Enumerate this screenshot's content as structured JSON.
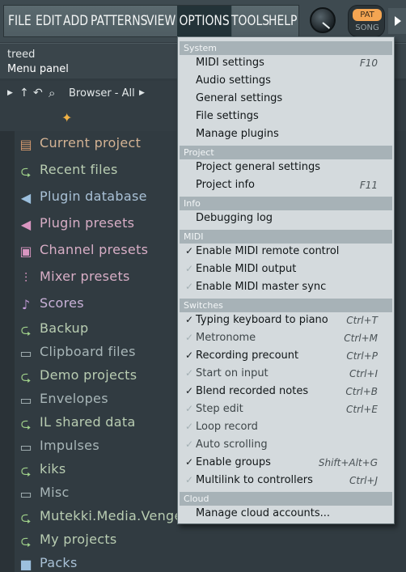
{
  "menubar": {
    "items": [
      {
        "label": "FILE"
      },
      {
        "label": "EDIT"
      },
      {
        "label": "ADD"
      },
      {
        "label": "PATTERNS"
      },
      {
        "label": "VIEW"
      },
      {
        "label": "OPTIONS"
      },
      {
        "label": "TOOLS"
      },
      {
        "label": "HELP"
      }
    ],
    "pat_label": "PAT",
    "song_label": "SONG"
  },
  "hint": {
    "line1": "treed",
    "line2": "Menu panel"
  },
  "browser": {
    "title": "Browser - All",
    "items": [
      {
        "label": "Current project",
        "icon": "document-icon",
        "color": "orange"
      },
      {
        "label": "Recent files",
        "icon": "folder-arrow-icon",
        "color": "green"
      },
      {
        "label": "Plugin database",
        "icon": "plug-icon",
        "color": "blue"
      },
      {
        "label": "Plugin presets",
        "icon": "plug-icon",
        "color": "pink"
      },
      {
        "label": "Channel presets",
        "icon": "channel-icon",
        "color": "pink"
      },
      {
        "label": "Mixer presets",
        "icon": "mixer-icon",
        "color": "pink"
      },
      {
        "label": "Scores",
        "icon": "note-icon",
        "color": "purple"
      },
      {
        "label": "Backup",
        "icon": "folder-arrow-icon",
        "color": "green"
      },
      {
        "label": "Clipboard files",
        "icon": "folder-icon",
        "color": "grey"
      },
      {
        "label": "Demo projects",
        "icon": "folder-arrow-icon",
        "color": "green"
      },
      {
        "label": "Envelopes",
        "icon": "folder-icon",
        "color": "grey"
      },
      {
        "label": "IL shared data",
        "icon": "folder-arrow-icon",
        "color": "green"
      },
      {
        "label": "Impulses",
        "icon": "folder-icon",
        "color": "grey"
      },
      {
        "label": "kiks",
        "icon": "folder-arrow-icon",
        "color": "green"
      },
      {
        "label": "Misc",
        "icon": "folder-icon",
        "color": "grey"
      },
      {
        "label": "Mutekki.Media.Vengea",
        "icon": "folder-arrow-icon",
        "color": "green"
      },
      {
        "label": "My projects",
        "icon": "folder-arrow-icon",
        "color": "green"
      },
      {
        "label": "Packs",
        "icon": "packs-icon",
        "color": "blue"
      }
    ]
  },
  "options_menu": {
    "sections": [
      {
        "header": "System",
        "items": [
          {
            "label": "MIDI settings",
            "shortcut": "F10",
            "check": ""
          },
          {
            "label": "Audio settings",
            "shortcut": "",
            "check": ""
          },
          {
            "label": "General settings",
            "shortcut": "",
            "check": ""
          },
          {
            "label": "File settings",
            "shortcut": "",
            "check": ""
          },
          {
            "label": "Manage plugins",
            "shortcut": "",
            "check": ""
          }
        ]
      },
      {
        "header": "Project",
        "items": [
          {
            "label": "Project general settings",
            "shortcut": "",
            "check": ""
          },
          {
            "label": "Project info",
            "shortcut": "F11",
            "check": ""
          }
        ]
      },
      {
        "header": "Info",
        "items": [
          {
            "label": "Debugging log",
            "shortcut": "",
            "check": ""
          }
        ]
      },
      {
        "header": "MIDI",
        "items": [
          {
            "label": "Enable MIDI remote control",
            "shortcut": "",
            "check": "on"
          },
          {
            "label": "Enable MIDI output",
            "shortcut": "",
            "check": "off"
          },
          {
            "label": "Enable MIDI master sync",
            "shortcut": "",
            "check": "off"
          }
        ]
      },
      {
        "header": "Switches",
        "items": [
          {
            "label": "Typing keyboard to piano",
            "shortcut": "Ctrl+T",
            "check": "on"
          },
          {
            "label": "Metronome",
            "shortcut": "Ctrl+M",
            "check": "off"
          },
          {
            "label": "Recording precount",
            "shortcut": "Ctrl+P",
            "check": "on"
          },
          {
            "label": "Start on input",
            "shortcut": "Ctrl+I",
            "check": "off"
          },
          {
            "label": "Blend recorded notes",
            "shortcut": "Ctrl+B",
            "check": "on"
          },
          {
            "label": "Step edit",
            "shortcut": "Ctrl+E",
            "check": "off"
          },
          {
            "label": "Loop record",
            "shortcut": "",
            "check": "off"
          },
          {
            "label": "Auto scrolling",
            "shortcut": "",
            "check": "off"
          },
          {
            "label": "Enable groups",
            "shortcut": "Shift+Alt+G",
            "check": "on"
          },
          {
            "label": "Multilink to controllers",
            "shortcut": "Ctrl+J",
            "check": "off"
          }
        ]
      },
      {
        "header": "Cloud",
        "items": [
          {
            "label": "Manage cloud accounts...",
            "shortcut": "",
            "check": ""
          }
        ]
      }
    ]
  },
  "colors": {
    "accent_orange": "#f4a552",
    "menu_bg": "#d4dadd",
    "section_header": "#a7b2b7",
    "browser_bg": "#313b41"
  }
}
